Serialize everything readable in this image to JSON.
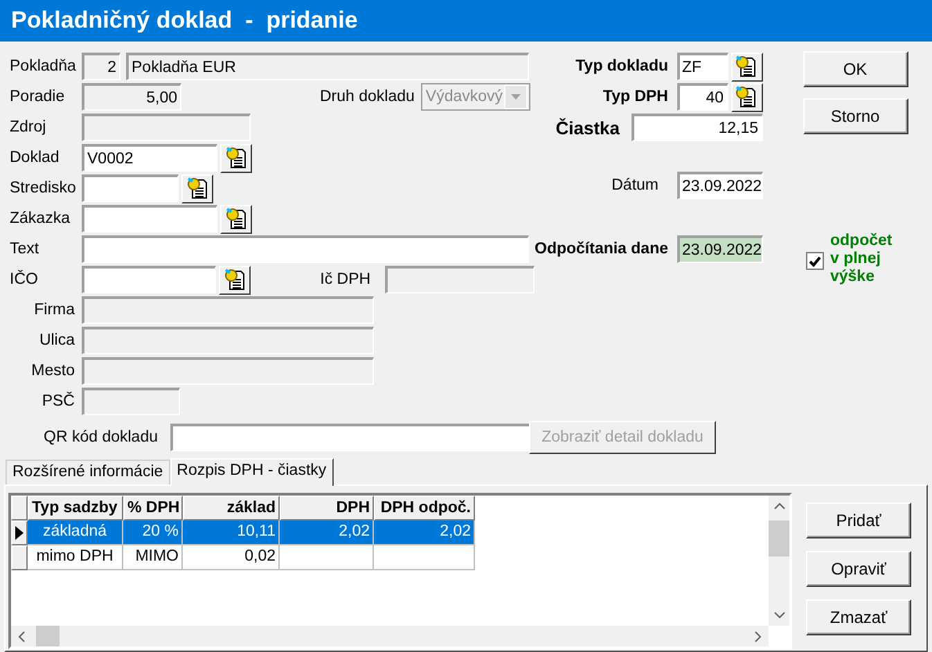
{
  "window": {
    "title": "Pokladničný doklad  -  pridanie"
  },
  "pokladna": {
    "label": "Pokladňa",
    "number": "2",
    "name": "Pokladňa EUR",
    "readonly": true
  },
  "poradie": {
    "label": "Poradie",
    "value": "5,00",
    "readonly": true
  },
  "druh_dokladu": {
    "label": "Druh dokladu",
    "value": "Výdavkový",
    "disabled": true
  },
  "zdroj": {
    "label": "Zdroj",
    "readonly": true
  },
  "doklad": {
    "label": "Doklad",
    "value": "V0002"
  },
  "stredisko": {
    "label": "Stredisko"
  },
  "zakazka": {
    "label": "Zákazka"
  },
  "text": {
    "label": "Text"
  },
  "ico": {
    "label": "IČO"
  },
  "ic_dph": {
    "label": "Ič DPH",
    "readonly": true
  },
  "address": [
    {
      "label": "Firma",
      "readonly": true
    },
    {
      "label": "Ulica",
      "readonly": true
    },
    {
      "label": "Mesto",
      "readonly": true
    },
    {
      "label": "PSČ",
      "readonly": true
    }
  ],
  "qr": {
    "label": "QR kód dokladu"
  },
  "detail_button": {
    "label": "Zobraziť detail dokladu",
    "disabled": true
  },
  "typ_dokladu": {
    "label": "Typ dokladu",
    "value": "ZF"
  },
  "typ_dph": {
    "label": "Typ DPH",
    "value": "40"
  },
  "ciastka": {
    "label": "Čiastka",
    "value": "12,15"
  },
  "datum": {
    "label": "Dátum",
    "value": "23.09.2022"
  },
  "odpocitania": {
    "label": "Odpočítania dane",
    "value": "23.09.2022"
  },
  "odpocet": {
    "label": "odpočet v plnej výške",
    "checked": true
  },
  "buttons": [
    "OK",
    "Storno"
  ],
  "tabs": [
    {
      "label": "Rozšírené informácie",
      "selected": false
    },
    {
      "label": "Rozpis DPH - čiastky",
      "selected": true
    }
  ],
  "table": {
    "columns": [
      "Typ sadzby",
      "% DPH",
      "základ",
      "DPH",
      "DPH odpoč."
    ],
    "rows": [
      {
        "cells": [
          "základná",
          "20 %",
          "10,11",
          "2,02",
          "2,02"
        ],
        "selected": true
      },
      {
        "cells": [
          "mimo DPH",
          "MIMO",
          "0,02",
          "",
          ""
        ],
        "selected": false
      }
    ]
  },
  "side_buttons": [
    "Pridať",
    "Opraviť",
    "Zmazať"
  ]
}
